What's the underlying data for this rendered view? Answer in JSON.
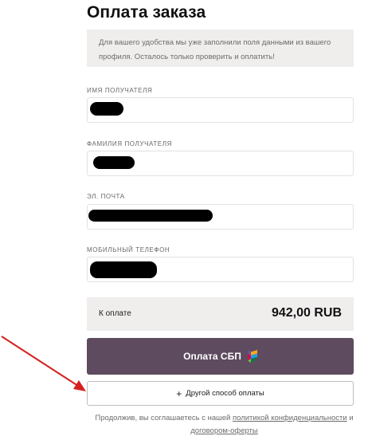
{
  "page": {
    "title": "Оплата заказа",
    "notice": "Для вашего удобства мы уже заполнили поля данными из вашего профиля. Осталось только проверить и оплатить!"
  },
  "form": {
    "first_name_label": "ИМЯ ПОЛУЧАТЕЛЯ",
    "last_name_label": "ФАМИЛИЯ ПОЛУЧАТЕЛЯ",
    "email_label": "ЭЛ. ПОЧТА",
    "phone_label": "МОБИЛЬНЫЙ ТЕЛЕФОН"
  },
  "summary": {
    "label": "К оплате",
    "amount": "942,00 RUB"
  },
  "actions": {
    "pay_sbp": "Оплата СБП",
    "other_method": "Другой способ оплаты"
  },
  "consent": {
    "prefix": "Продолжив, вы соглашаетесь с нашей",
    "privacy_link": "политикой конфиденциальности",
    "and": "и",
    "offer_link": "договором-оферты"
  },
  "colors": {
    "accent": "#5e4b60",
    "annotation_arrow": "#d42020"
  },
  "icons": {
    "sbp": "sbp-logo-icon",
    "plus": "plus-icon"
  }
}
